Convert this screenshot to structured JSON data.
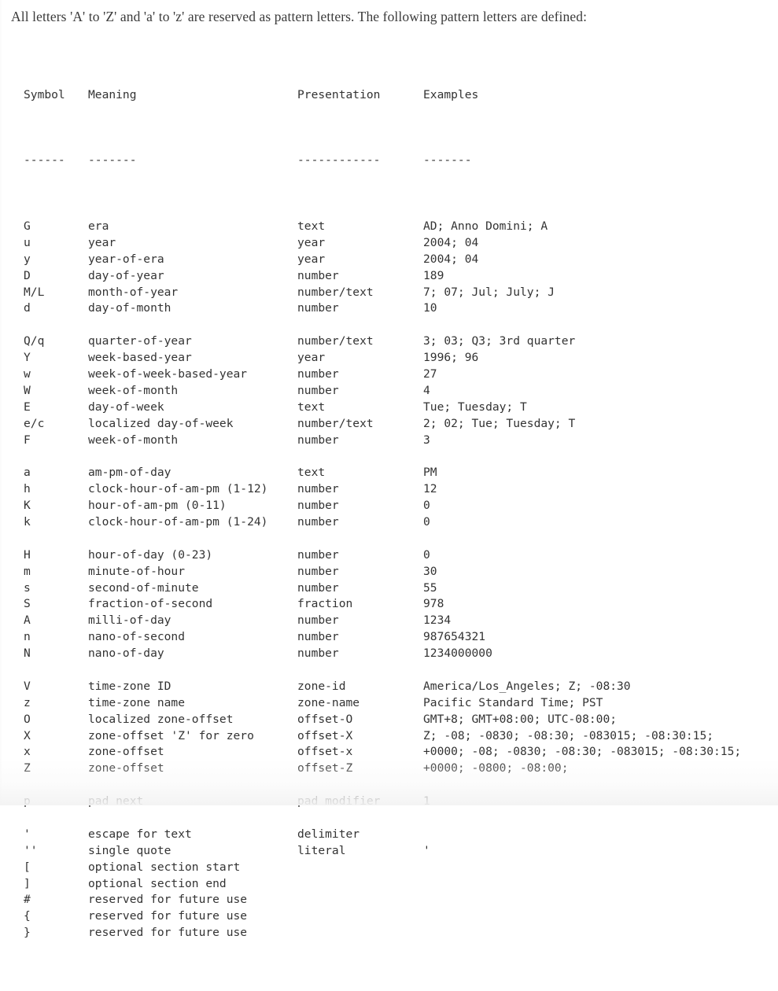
{
  "document": {
    "intro": "All letters 'A' to 'Z' and 'a' to 'z' are reserved as pattern letters. The following pattern letters are defined:"
  },
  "table": {
    "headers": {
      "symbol": "Symbol",
      "meaning": "Meaning",
      "presentation": "Presentation",
      "examples": "Examples"
    },
    "rules": {
      "symbol": "------",
      "meaning": "-------",
      "presentation": "------------",
      "examples": "-------"
    },
    "groups": [
      {
        "rows": [
          {
            "symbol": "G",
            "meaning": "era",
            "presentation": "text",
            "examples": "AD; Anno Domini; A"
          },
          {
            "symbol": "u",
            "meaning": "year",
            "presentation": "year",
            "examples": "2004; 04"
          },
          {
            "symbol": "y",
            "meaning": "year-of-era",
            "presentation": "year",
            "examples": "2004; 04"
          },
          {
            "symbol": "D",
            "meaning": "day-of-year",
            "presentation": "number",
            "examples": "189"
          },
          {
            "symbol": "M/L",
            "meaning": "month-of-year",
            "presentation": "number/text",
            "examples": "7; 07; Jul; July; J"
          },
          {
            "symbol": "d",
            "meaning": "day-of-month",
            "presentation": "number",
            "examples": "10"
          }
        ]
      },
      {
        "rows": [
          {
            "symbol": "Q/q",
            "meaning": "quarter-of-year",
            "presentation": "number/text",
            "examples": "3; 03; Q3; 3rd quarter"
          },
          {
            "symbol": "Y",
            "meaning": "week-based-year",
            "presentation": "year",
            "examples": "1996; 96"
          },
          {
            "symbol": "w",
            "meaning": "week-of-week-based-year",
            "presentation": "number",
            "examples": "27"
          },
          {
            "symbol": "W",
            "meaning": "week-of-month",
            "presentation": "number",
            "examples": "4"
          },
          {
            "symbol": "E",
            "meaning": "day-of-week",
            "presentation": "text",
            "examples": "Tue; Tuesday; T"
          },
          {
            "symbol": "e/c",
            "meaning": "localized day-of-week",
            "presentation": "number/text",
            "examples": "2; 02; Tue; Tuesday; T"
          },
          {
            "symbol": "F",
            "meaning": "week-of-month",
            "presentation": "number",
            "examples": "3"
          }
        ]
      },
      {
        "rows": [
          {
            "symbol": "a",
            "meaning": "am-pm-of-day",
            "presentation": "text",
            "examples": "PM"
          },
          {
            "symbol": "h",
            "meaning": "clock-hour-of-am-pm (1-12)",
            "presentation": "number",
            "examples": "12"
          },
          {
            "symbol": "K",
            "meaning": "hour-of-am-pm (0-11)",
            "presentation": "number",
            "examples": "0"
          },
          {
            "symbol": "k",
            "meaning": "clock-hour-of-am-pm (1-24)",
            "presentation": "number",
            "examples": "0"
          }
        ]
      },
      {
        "rows": [
          {
            "symbol": "H",
            "meaning": "hour-of-day (0-23)",
            "presentation": "number",
            "examples": "0"
          },
          {
            "symbol": "m",
            "meaning": "minute-of-hour",
            "presentation": "number",
            "examples": "30"
          },
          {
            "symbol": "s",
            "meaning": "second-of-minute",
            "presentation": "number",
            "examples": "55"
          },
          {
            "symbol": "S",
            "meaning": "fraction-of-second",
            "presentation": "fraction",
            "examples": "978"
          },
          {
            "symbol": "A",
            "meaning": "milli-of-day",
            "presentation": "number",
            "examples": "1234"
          },
          {
            "symbol": "n",
            "meaning": "nano-of-second",
            "presentation": "number",
            "examples": "987654321"
          },
          {
            "symbol": "N",
            "meaning": "nano-of-day",
            "presentation": "number",
            "examples": "1234000000"
          }
        ]
      },
      {
        "rows": [
          {
            "symbol": "V",
            "meaning": "time-zone ID",
            "presentation": "zone-id",
            "examples": "America/Los_Angeles; Z; -08:30"
          },
          {
            "symbol": "z",
            "meaning": "time-zone name",
            "presentation": "zone-name",
            "examples": "Pacific Standard Time; PST"
          },
          {
            "symbol": "O",
            "meaning": "localized zone-offset",
            "presentation": "offset-O",
            "examples": "GMT+8; GMT+08:00; UTC-08:00;"
          },
          {
            "symbol": "X",
            "meaning": "zone-offset 'Z' for zero",
            "presentation": "offset-X",
            "examples": "Z; -08; -0830; -08:30; -083015; -08:30:15;"
          },
          {
            "symbol": "x",
            "meaning": "zone-offset",
            "presentation": "offset-x",
            "examples": "+0000; -08; -0830; -08:30; -083015; -08:30:15;"
          },
          {
            "symbol": "Z",
            "meaning": "zone-offset",
            "presentation": "offset-Z",
            "examples": "+0000; -0800; -08:00;"
          }
        ]
      },
      {
        "rows": [
          {
            "symbol": "p",
            "meaning": "pad next",
            "presentation": "pad modifier",
            "examples": "1"
          }
        ]
      },
      {
        "rows": [
          {
            "symbol": "'",
            "meaning": "escape for text",
            "presentation": "delimiter",
            "examples": ""
          },
          {
            "symbol": "''",
            "meaning": "single quote",
            "presentation": "literal",
            "examples": "'"
          },
          {
            "symbol": "[",
            "meaning": "optional section start",
            "presentation": "",
            "examples": ""
          },
          {
            "symbol": "]",
            "meaning": "optional section end",
            "presentation": "",
            "examples": ""
          },
          {
            "symbol": "#",
            "meaning": "reserved for future use",
            "presentation": "",
            "examples": ""
          },
          {
            "symbol": "{",
            "meaning": "reserved for future use",
            "presentation": "",
            "examples": ""
          },
          {
            "symbol": "}",
            "meaning": "reserved for future use",
            "presentation": "",
            "examples": ""
          }
        ]
      }
    ]
  }
}
